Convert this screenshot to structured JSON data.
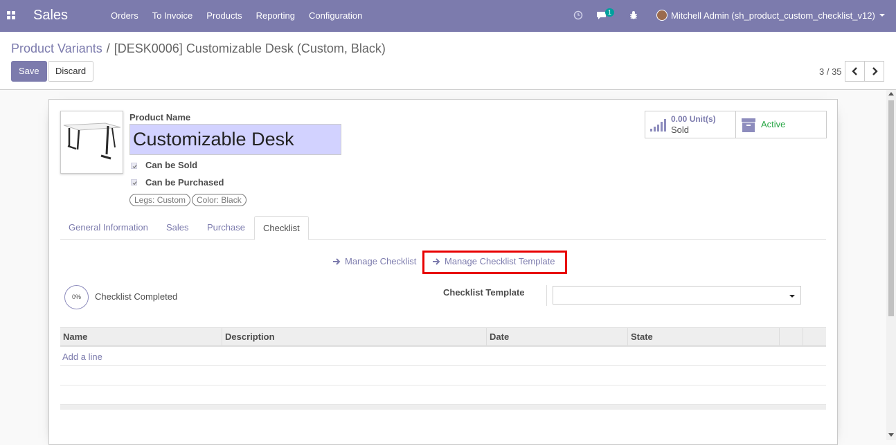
{
  "navbar": {
    "app_name": "Sales",
    "menu": [
      "Orders",
      "To Invoice",
      "Products",
      "Reporting",
      "Configuration"
    ],
    "chat_badge": "1",
    "user_label": "Mitchell Admin (sh_product_custom_checklist_v12)"
  },
  "breadcrumb": {
    "parent": "Product Variants",
    "separator": "/",
    "current": "[DESK0006] Customizable Desk (Custom, Black)"
  },
  "buttons": {
    "save": "Save",
    "discard": "Discard"
  },
  "pager": {
    "text": "3 / 35"
  },
  "product": {
    "name_label": "Product Name",
    "name_value": "Customizable Desk",
    "can_be_sold_label": "Can be Sold",
    "can_be_sold": true,
    "can_be_purchased_label": "Can be Purchased",
    "can_be_purchased": true,
    "attributes": [
      "Legs: Custom",
      "Color: Black"
    ]
  },
  "stat_buttons": {
    "sold_value": "0.00 Unit(s)",
    "sold_label": "Sold",
    "active_label": "Active"
  },
  "tabs": [
    "General Information",
    "Sales",
    "Purchase",
    "Checklist"
  ],
  "active_tab": "Checklist",
  "checklist": {
    "manage_checklist": "Manage Checklist",
    "manage_template": "Manage Checklist Template",
    "progress_text": "0%",
    "progress_value": 0,
    "completed_label": "Checklist Completed",
    "template_label": "Checklist Template",
    "template_value": ""
  },
  "table": {
    "columns": [
      "Name",
      "Description",
      "Date",
      "State"
    ],
    "add_line": "Add a line"
  },
  "colors": {
    "brand": "#7c7bad",
    "highlight": "#e80000",
    "active_status": "#28a745"
  }
}
